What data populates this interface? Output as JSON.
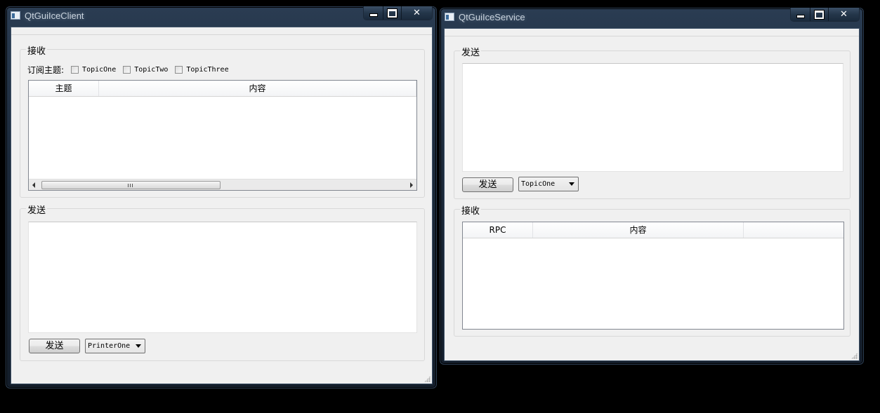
{
  "client_window": {
    "title": "QtGuiIceClient",
    "receive_group": {
      "title": "接收",
      "subscribe_label": "订阅主题:",
      "topics": [
        "TopicOne",
        "TopicTwo",
        "TopicThree"
      ],
      "table_headers": [
        "主题",
        "内容"
      ],
      "scrollbar_grip": "III"
    },
    "send_group": {
      "title": "发送",
      "send_button": "发送",
      "printer_select": "PrinterOne"
    }
  },
  "service_window": {
    "title": "QtGuiIceService",
    "send_group": {
      "title": "发送",
      "send_button": "发送",
      "topic_select": "TopicOne"
    },
    "receive_group": {
      "title": "接收",
      "table_headers": [
        "RPC",
        "内容",
        ""
      ]
    }
  },
  "caption_buttons": {
    "close_glyph": "✕"
  }
}
